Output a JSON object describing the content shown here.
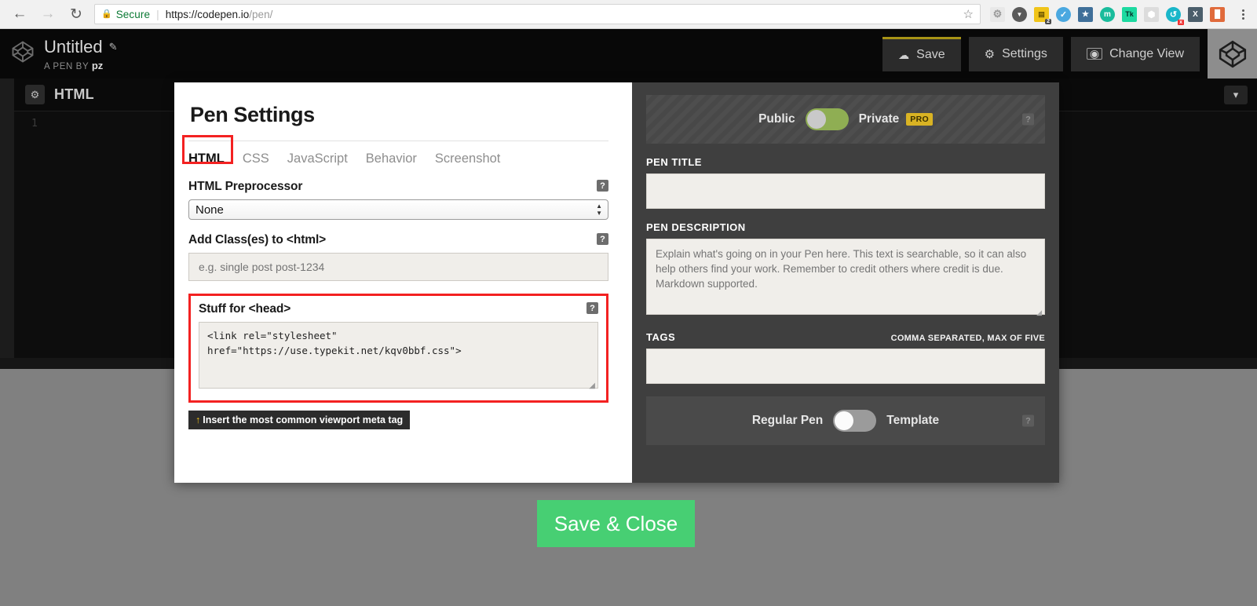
{
  "browser": {
    "back_icon": "back-arrow-icon",
    "forward_icon": "forward-arrow-icon",
    "reload_icon": "reload-icon",
    "security_label": "Secure",
    "url_domain": "https://codepen.io",
    "url_path": "/pen/",
    "bookmark_icon": "star-icon",
    "extensions": [
      {
        "name": "gear-extension-icon",
        "glyph": "⚙",
        "bg": "#e8e8e8",
        "fg": "#9a9a9a"
      },
      {
        "name": "pocket-extension-icon",
        "glyph": "▼",
        "bg": "#5a5a5a",
        "fg": "#ffffff"
      },
      {
        "name": "notes-extension-icon",
        "glyph": "▤",
        "bg": "#f0c419",
        "fg": "#6b5500",
        "badge": "2"
      },
      {
        "name": "check-extension-icon",
        "glyph": "✓",
        "bg": "#4aa8e0",
        "fg": "#ffffff"
      },
      {
        "name": "star-extension-icon",
        "glyph": "★",
        "bg": "#3f6f99",
        "fg": "#ffffff"
      },
      {
        "name": "m-extension-icon",
        "glyph": "m",
        "bg": "#1abc9c",
        "fg": "#ffffff"
      },
      {
        "name": "tk-extension-icon",
        "glyph": "Tk",
        "bg": "#1dd9a0",
        "fg": "#0a3a2a"
      },
      {
        "name": "shield-extension-icon",
        "glyph": "⬢",
        "bg": "#d8d8d8",
        "fg": "#ffffff"
      },
      {
        "name": "sync-extension-icon",
        "glyph": "↺",
        "bg": "#19b6c9",
        "fg": "#ffffff",
        "badge": "x"
      },
      {
        "name": "x-extension-icon",
        "glyph": "X",
        "bg": "#4b5e6b",
        "fg": "#ffffff"
      },
      {
        "name": "lighthouse-extension-icon",
        "glyph": "▐",
        "bg": "#e06a3b",
        "fg": "#ffffff"
      }
    ],
    "menu_icon": "kebab-menu-icon"
  },
  "cp_header": {
    "logo_icon": "codepen-logo-icon",
    "pen_title": "Untitled",
    "edit_icon": "pencil-icon",
    "byline_prefix": "A PEN BY",
    "byline_user": "pz",
    "save_label": "Save",
    "save_icon": "cloud-icon",
    "settings_label": "Settings",
    "settings_icon": "gear-icon",
    "change_view_label": "Change View",
    "change_view_icon": "screen-icon",
    "avatar_icon": "codepen-avatar-icon",
    "save_unsaved_accent": "#a89416"
  },
  "editor": {
    "gear_icon": "gear-icon",
    "panel_label": "HTML",
    "line_number": "1",
    "collapse_icon": "chevron-down-icon"
  },
  "modal": {
    "title": "Pen Settings",
    "tabs": [
      {
        "label": "HTML",
        "active": true,
        "name": "tab-html"
      },
      {
        "label": "CSS",
        "active": false,
        "name": "tab-css"
      },
      {
        "label": "JavaScript",
        "active": false,
        "name": "tab-javascript"
      },
      {
        "label": "Behavior",
        "active": false,
        "name": "tab-behavior"
      },
      {
        "label": "Screenshot",
        "active": false,
        "name": "tab-screenshot"
      }
    ],
    "preprocessor": {
      "label": "HTML Preprocessor",
      "value": "None",
      "help_glyph": "?"
    },
    "add_class": {
      "label": "Add Class(es) to <html>",
      "value": "",
      "placeholder": "e.g. single post post-1234",
      "help_glyph": "?"
    },
    "stuff_for_head": {
      "label": "Stuff for <head>",
      "value": "<link rel=\"stylesheet\" href=\"https://use.typekit.net/kqv0bbf.css\">",
      "help_glyph": "?"
    },
    "viewport_button": {
      "arrow": "↑",
      "label": "Insert the most common viewport meta tag"
    },
    "annotation_color": "#f32121"
  },
  "right_panel": {
    "privacy_toggle": {
      "left_label": "Public",
      "right_label": "Private",
      "pro_badge": "PRO",
      "state": "left",
      "help_glyph": "?",
      "track_color": "#8fae53"
    },
    "pen_title": {
      "label": "PEN TITLE",
      "value": "",
      "placeholder": ""
    },
    "pen_description": {
      "label": "PEN DESCRIPTION",
      "value": "",
      "placeholder": "Explain what's going on in your Pen here. This text is searchable, so it can also help others find your work. Remember to credit others where credit is due. Markdown supported."
    },
    "tags": {
      "label": "TAGS",
      "hint": "COMMA SEPARATED, MAX OF FIVE",
      "value": "",
      "placeholder": ""
    },
    "template_toggle": {
      "left_label": "Regular Pen",
      "right_label": "Template",
      "state": "left",
      "help_glyph": "?",
      "track_color": "#9b9b9b"
    }
  },
  "footer": {
    "save_close_label": "Save & Close",
    "save_close_color": "#47cf73"
  }
}
